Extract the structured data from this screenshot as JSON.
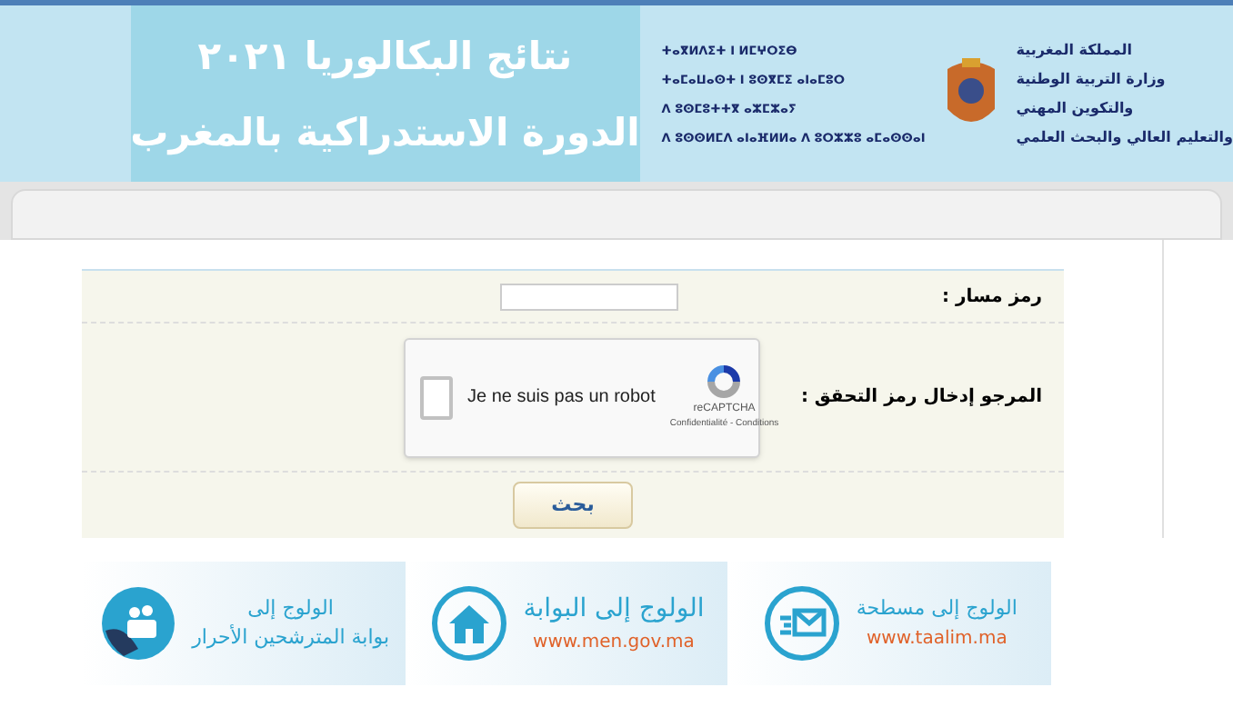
{
  "header": {
    "title_lines": [
      "نتائج البكالوريا ٢٠٢١",
      "الدورة الاستدراكية بالمغرب"
    ],
    "tifinagh_lines": [
      "ⵜⴰⴳⵍⴷⵉⵜ ⵏ ⵍⵎⵖⵔⵉⴱ",
      "ⵜⴰⵎⴰⵡⴰⵙⵜ ⵏ ⵓⵙⴳⵎⵉ ⴰⵏⴰⵎⵓⵔ",
      "ⴷ ⵓⵙⵎⵓⵜⵜⴳ ⴰⵣⵎⵣⴰⵢ",
      "ⴷ ⵓⵙⵙⵍⵎⴷ ⴰⵏⴰⴼⵍⵍⴰ ⴷ ⵓⵔⵣⵣⵓ ⴰⵎⴰⵙⵙⴰⵏ"
    ],
    "arabic_lines": [
      "المملكة المغربية",
      "وزارة التربية الوطنية",
      "والتكوين المهني",
      "والتعليم العالي والبحث العلمي"
    ]
  },
  "form": {
    "code_label": "رمز مسار :",
    "captcha_label": "المرجو إدخال رمز التحقق :",
    "captcha": {
      "checked": false,
      "text": "Je ne suis pas un robot",
      "brand": "reCAPTCHA",
      "links": "Confidentialité - Conditions"
    },
    "submit": "بحث"
  },
  "banners": [
    {
      "kind": "mail",
      "line1": "الولوج إلى مسطحة",
      "line2": "www.taalim.ma"
    },
    {
      "kind": "home",
      "line1": "الولوج إلى البوابة",
      "line2": "www.men.gov.ma"
    },
    {
      "kind": "portal",
      "line1": "الولوج إلى",
      "line2": "بوابة المترشحين الأحرار"
    }
  ]
}
